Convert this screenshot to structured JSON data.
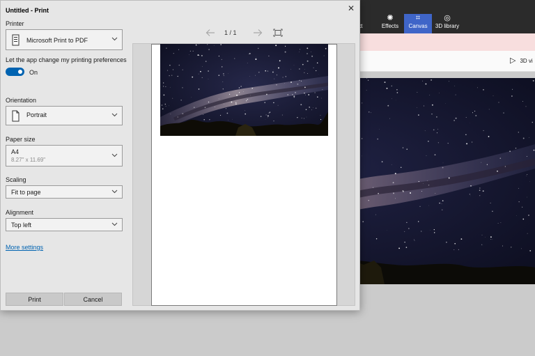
{
  "dialog": {
    "title": "Untitled - Print",
    "close_icon": "close-icon",
    "printer_label": "Printer",
    "printer_value": "Microsoft Print to PDF",
    "printer_icon": "printer-icon",
    "prefs_label": "Let the app change my printing preferences",
    "prefs_state": "On",
    "prefs_enabled": true,
    "orientation_label": "Orientation",
    "orientation_value": "Portrait",
    "orientation_icon": "portrait-page-icon",
    "paper_size_label": "Paper size",
    "paper_size_value": "A4",
    "paper_size_dims": "8.27\" x 11.69\"",
    "scaling_label": "Scaling",
    "scaling_value": "Fit to page",
    "alignment_label": "Alignment",
    "alignment_value": "Top left",
    "more_settings": "More settings",
    "print_button": "Print",
    "cancel_button": "Cancel"
  },
  "preview": {
    "page_indicator": "1 / 1",
    "prev_icon": "arrow-left-icon",
    "next_icon": "arrow-right-icon",
    "fit_icon": "fit-page-icon"
  },
  "app": {
    "toolbar": [
      {
        "label": "ext",
        "icon": "text-icon"
      },
      {
        "label": "Effects",
        "icon": "effects-icon"
      },
      {
        "label": "Canvas",
        "icon": "canvas-icon",
        "active": true
      },
      {
        "label": "3D library",
        "icon": "3d-library-icon"
      }
    ],
    "view_3d_label": "3D vi",
    "view_3d_icon": "view-3d-icon"
  },
  "colors": {
    "accent": "#0063b1",
    "toolbar_bg": "#2b2b2b",
    "active_tool": "#3f65c8",
    "banner": "#f8dede",
    "dialog_bg": "#e6e6e6"
  }
}
